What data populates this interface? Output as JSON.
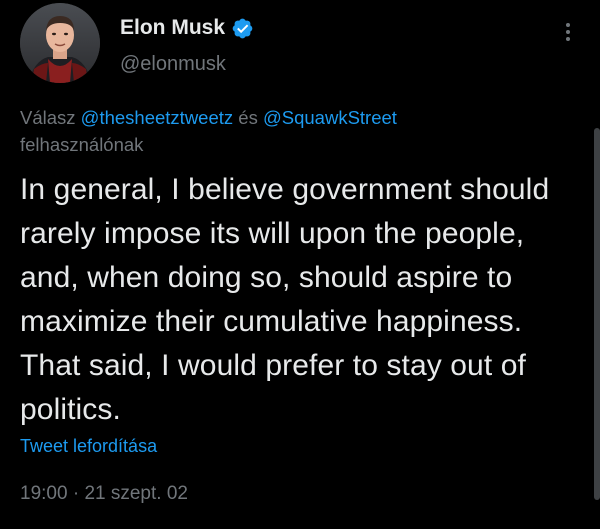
{
  "author": {
    "name": "Elon Musk",
    "handle": "@elonmusk",
    "verified": true,
    "verified_color": "#1d9bf0"
  },
  "reply": {
    "prefix": "Válasz",
    "mention_1": "@thesheetztweetz",
    "connector": "és",
    "mention_2": "@SquawkStreet",
    "suffix": "felhasználónak"
  },
  "tweet": {
    "text": "In general, I believe government should rarely impose its will upon the people, and, when doing so, should aspire to maximize their cumulative happiness. That said, I would prefer to stay out of politics.",
    "translate_label": "Tweet lefordítása",
    "time": "19:00",
    "separator": "·",
    "date": "21 szept. 02"
  },
  "colors": {
    "background": "#000000",
    "text": "#e7e9ea",
    "muted": "#71767b",
    "accent": "#1d9bf0"
  },
  "icons": {
    "verified": "verified-badge-icon",
    "more": "more-options-icon"
  }
}
